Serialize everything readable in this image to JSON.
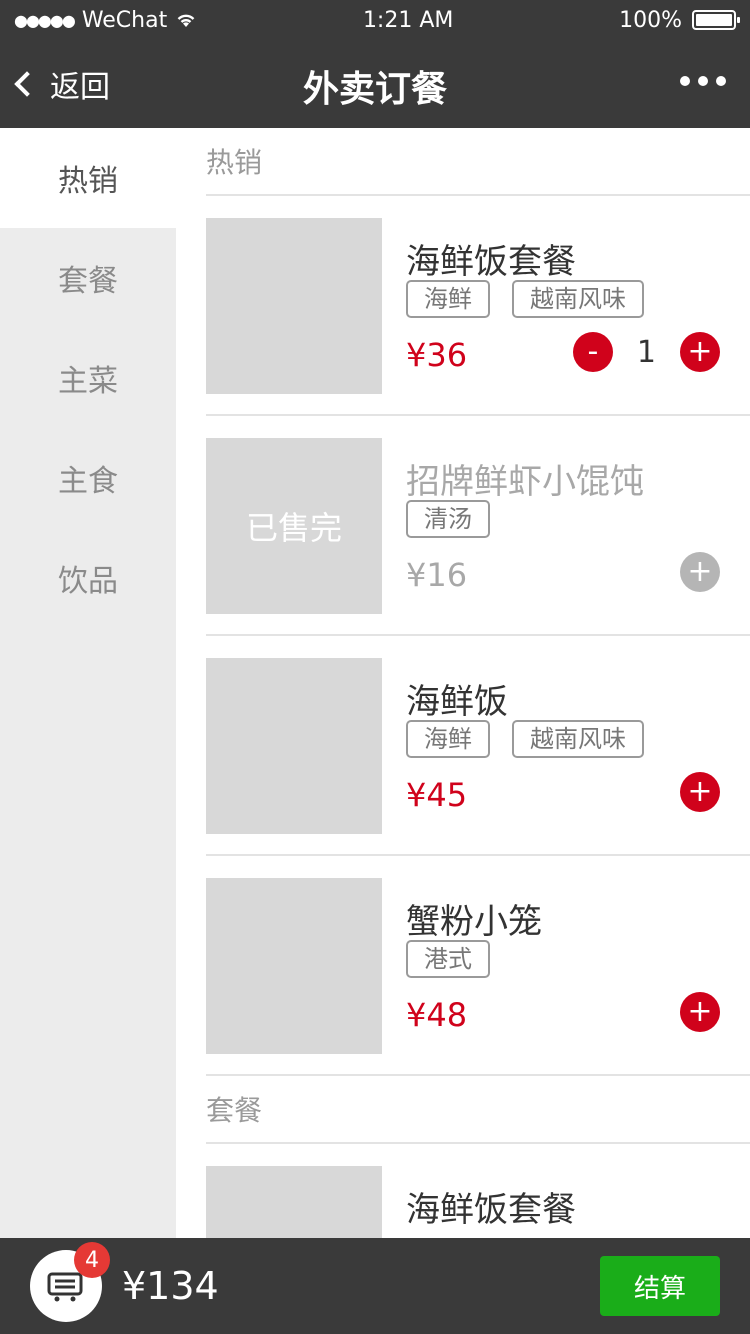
{
  "status_bar": {
    "signal": "●●●●●",
    "carrier": "WeChat",
    "time": "1:21 AM",
    "battery": "100%"
  },
  "nav": {
    "back_label": "返回",
    "title": "外卖订餐"
  },
  "sidebar": {
    "items": [
      {
        "label": "热销",
        "active": true
      },
      {
        "label": "套餐"
      },
      {
        "label": "主菜"
      },
      {
        "label": "主食"
      },
      {
        "label": "饮品"
      }
    ]
  },
  "sections": [
    {
      "title": "热销",
      "items": [
        {
          "name": "海鲜饭套餐",
          "tags": [
            "海鲜",
            "越南风味"
          ],
          "price": "¥36",
          "minus": "-",
          "qty": "1",
          "plus": "+"
        },
        {
          "name": "招牌鲜虾小馄饨",
          "tags": [
            "清汤"
          ],
          "price": "¥16",
          "sold_out_label": "已售完",
          "plus": "+"
        },
        {
          "name": "海鲜饭",
          "tags": [
            "海鲜",
            "越南风味"
          ],
          "price": "¥45",
          "plus": "+"
        },
        {
          "name": "蟹粉小笼",
          "tags": [
            "港式"
          ],
          "price": "¥48",
          "plus": "+"
        }
      ]
    },
    {
      "title": "套餐",
      "items": [
        {
          "name": "海鲜饭套餐"
        }
      ]
    }
  ],
  "cart": {
    "count": "4",
    "total": "¥134",
    "checkout_label": "结算"
  },
  "colors": {
    "accent_red": "#d0021b",
    "checkout_green": "#1aad19",
    "bar_bg": "#3a3a3a"
  }
}
